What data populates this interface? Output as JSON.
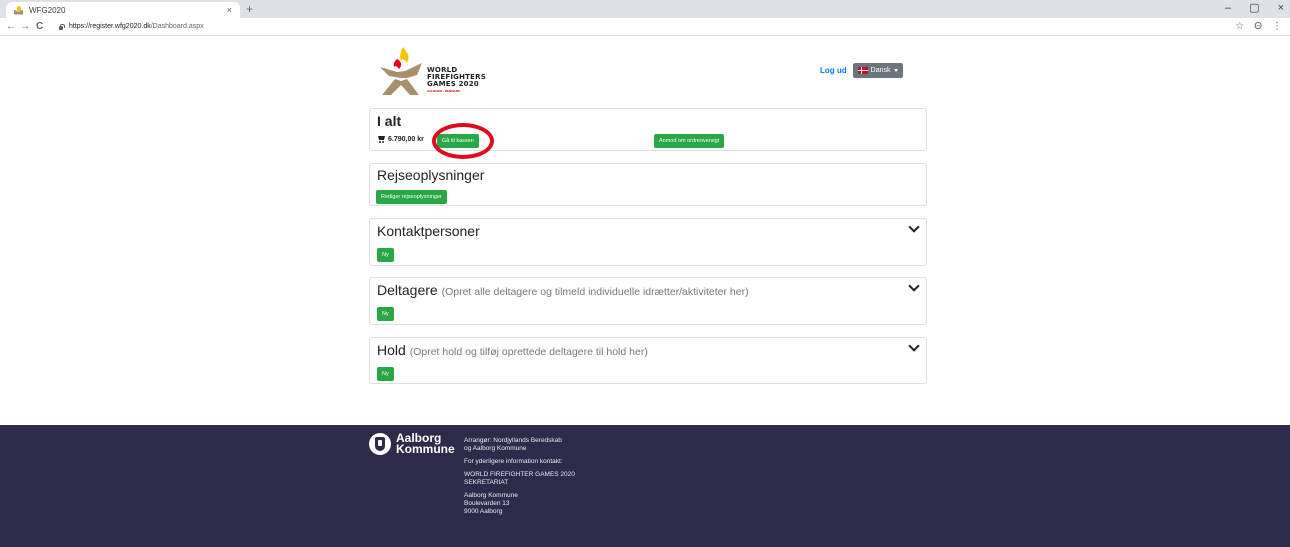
{
  "browser": {
    "tab_title": "WFG2020",
    "tab_close": "×",
    "new_tab": "+",
    "url_host": "https://register.wfg2020.dk",
    "url_path": "/Dashboard.aspx",
    "back": "←",
    "forward": "→",
    "reload": "C",
    "star": "☆",
    "profile": "Θ",
    "menu": "⋮",
    "minimize": "–",
    "maximize": "▢",
    "close": "×"
  },
  "logo": {
    "line1": "WORLD",
    "line2": "FIREFIGHTERS",
    "line3": "GAMES 2020",
    "sub": "AALBORG · DENMARK"
  },
  "header": {
    "logout": "Log ud",
    "language": "Dansk"
  },
  "total_card": {
    "title": "I alt",
    "amount": "6.790,00 kr",
    "checkout_button": "Gå til kassen",
    "request_button": "Anmod om ordreoversigt"
  },
  "travel_card": {
    "title": "Rejseoplysninger",
    "edit_button": "Rediger rejseoplysninger"
  },
  "contacts_card": {
    "title": "Kontaktpersoner",
    "new_button": "Ny"
  },
  "participants_card": {
    "title": "Deltagere",
    "subtitle": "(Opret alle deltagere og tilmeld individuelle idrætter/aktiviteter her)",
    "new_button": "Ny"
  },
  "teams_card": {
    "title": "Hold",
    "subtitle": "(Opret hold og tilføj oprettede deltagere til hold her)",
    "new_button": "Ny"
  },
  "footer": {
    "logo_line1": "Aalborg",
    "logo_line2": "Kommune",
    "organizer_line1": "Arrangør: Nordjyllands Beredskab",
    "organizer_line2": "og Aalborg Kommune",
    "contact_info": "For yderligere information kontakt:",
    "secretariat_line1": "WORLD FIREFIGHTER GAMES 2020",
    "secretariat_line2": "SEKRETARIAT",
    "address_line1": "Aalborg Kommune",
    "address_line2": "Boulevarden 13",
    "address_line3": "9000 Aalborg"
  },
  "colors": {
    "green": "#28a745",
    "link": "#007bff",
    "footer_bg": "#2e2b4a",
    "annotation": "#e0091e"
  }
}
